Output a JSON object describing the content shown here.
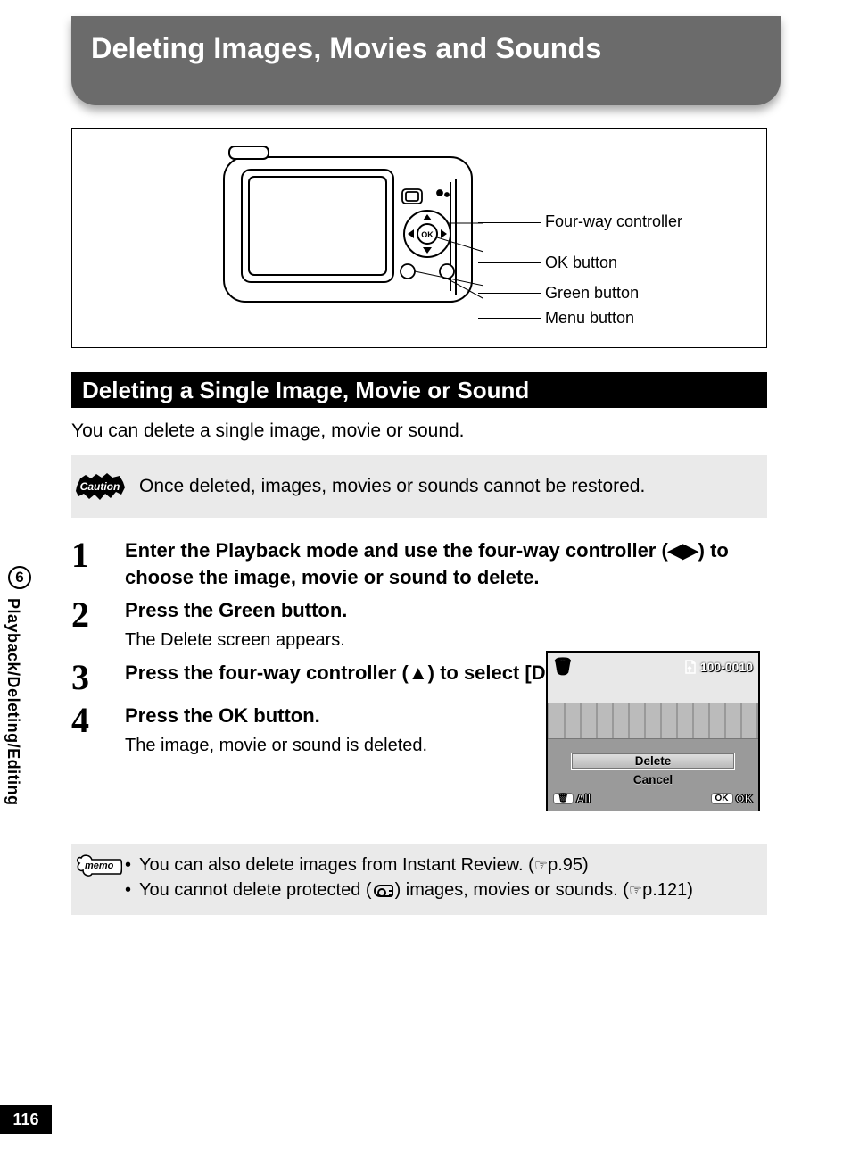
{
  "chapterTitle": "Deleting Images, Movies and Sounds",
  "diagram": {
    "labels": {
      "fourWay": "Four-way controller",
      "ok": "OK button",
      "green": "Green button",
      "menu": "Menu button"
    }
  },
  "sectionTitle": "Deleting a Single Image, Movie or Sound",
  "introText": "You can delete a single image, movie or sound.",
  "caution": {
    "badge": "Caution",
    "text": "Once deleted, images, movies or sounds cannot be restored."
  },
  "steps": [
    {
      "num": "1",
      "title": "Enter the Playback mode and use the four-way controller (◀▶) to choose the image, movie or sound to delete."
    },
    {
      "num": "2",
      "title": "Press the Green button.",
      "sub": "The Delete screen appears."
    },
    {
      "num": "3",
      "title": "Press the four-way controller (▲) to select [Delete]."
    },
    {
      "num": "4",
      "title": "Press the OK button.",
      "sub": "The image, movie or sound is deleted."
    }
  ],
  "lcd": {
    "fileNum": "100-0010",
    "optionDelete": "Delete",
    "optionCancel": "Cancel",
    "allLabel": "All",
    "okBadge": "OK",
    "okLabel": "OK"
  },
  "memo": {
    "badge": "memo",
    "items": [
      {
        "pre": "You can also delete images from Instant Review. (",
        "ref": "p.95",
        "post": ")"
      },
      {
        "pre": "You cannot delete protected (",
        "mid": ") images, movies or sounds. (",
        "ref": "p.121",
        "post": ")"
      }
    ]
  },
  "sideTab": {
    "num": "6",
    "label": "Playback/Deleting/Editing"
  },
  "pageNum": "116"
}
